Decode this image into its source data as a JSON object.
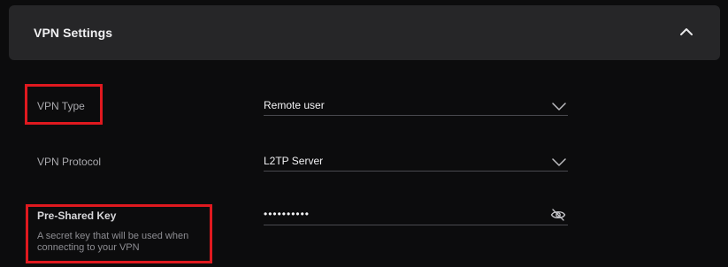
{
  "panel": {
    "title": "VPN Settings",
    "collapse_icon": "chevron-up-icon"
  },
  "fields": {
    "vpn_type": {
      "label": "VPN Type",
      "value": "Remote user",
      "icon": "chevron-down-icon"
    },
    "vpn_protocol": {
      "label": "VPN Protocol",
      "value": "L2TP Server",
      "icon": "chevron-down-icon"
    },
    "pre_shared_key": {
      "label": "Pre-Shared Key",
      "hint": "A secret key that will be used when connecting to your VPN",
      "masked_value": "••••••••••",
      "icon": "eye-off-icon"
    }
  },
  "colors": {
    "background": "#0c0c0d",
    "panel": "#262628",
    "highlight": "#e0191f"
  }
}
